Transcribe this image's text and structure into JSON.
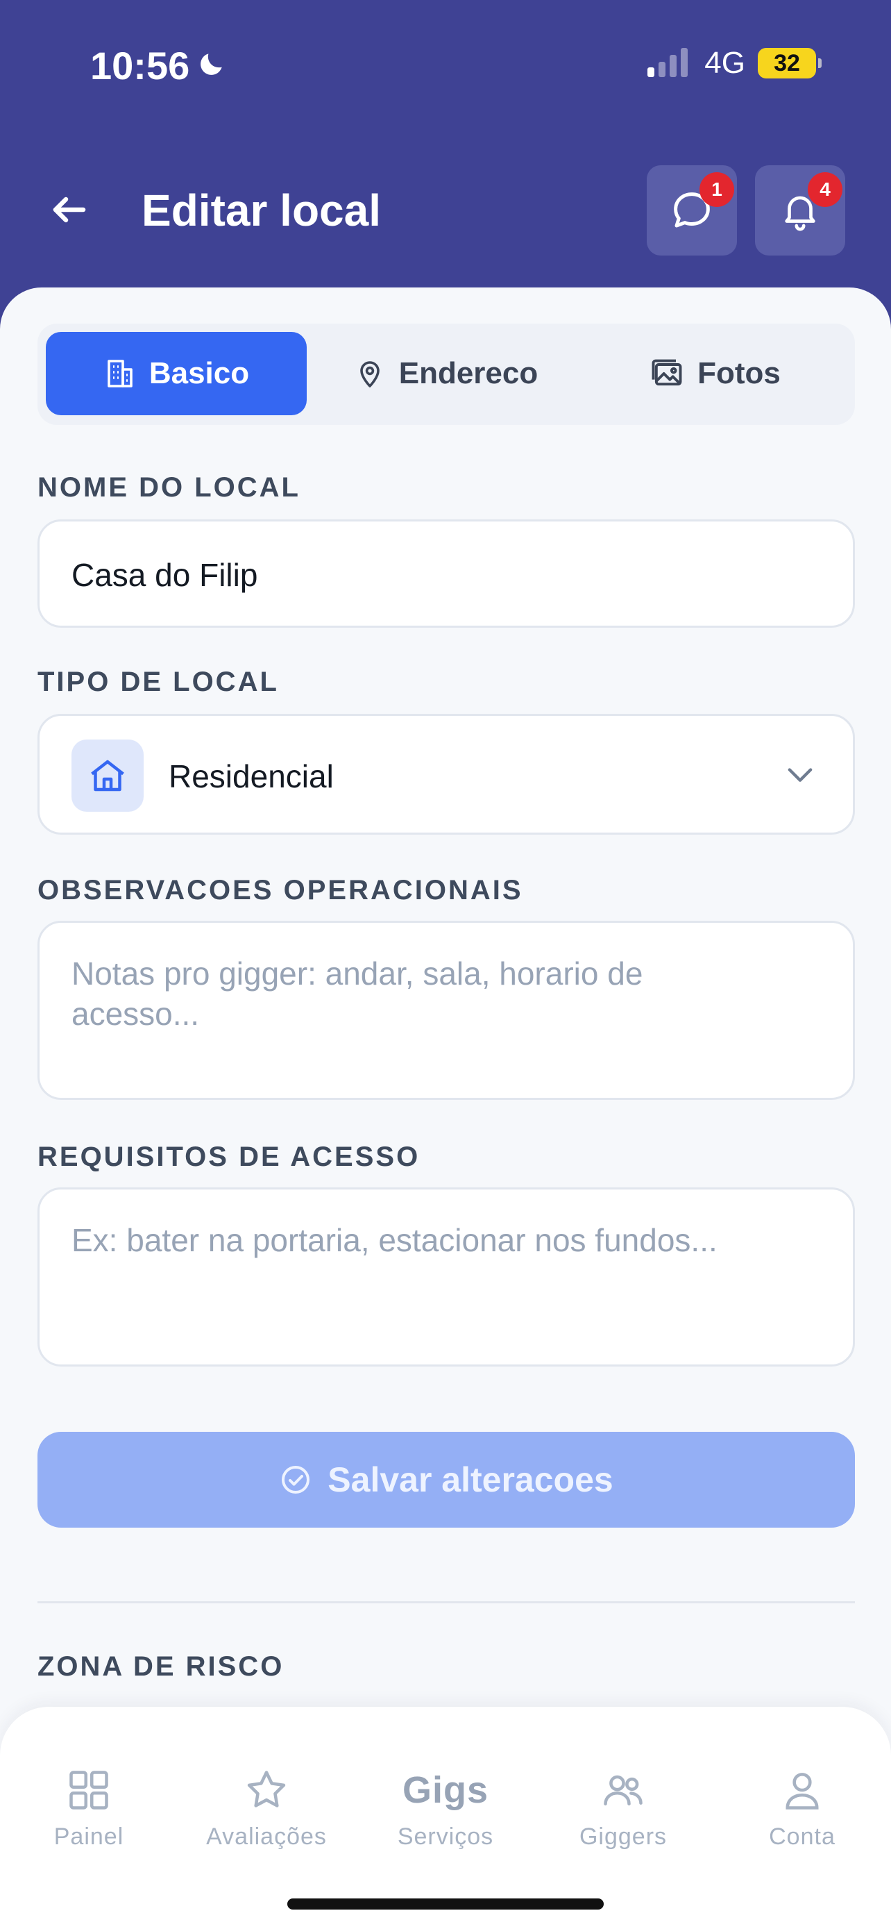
{
  "status_bar": {
    "time": "10:56",
    "network": "4G",
    "battery": "32"
  },
  "header": {
    "title": "Editar local",
    "messages_badge": "1",
    "notifications_badge": "4"
  },
  "tabs": [
    {
      "label": "Basico",
      "icon": "building-icon",
      "active": true
    },
    {
      "label": "Endereco",
      "icon": "map-pin-icon",
      "active": false
    },
    {
      "label": "Fotos",
      "icon": "image-icon",
      "active": false
    }
  ],
  "form": {
    "name_label": "NOME DO LOCAL",
    "name_value": "Casa do Filip",
    "type_label": "TIPO DE LOCAL",
    "type_value": "Residencial",
    "notes_label": "OBSERVACOES OPERACIONAIS",
    "notes_placeholder": "Notas pro gigger: andar, sala, horario de acesso...",
    "access_label": "REQUISITOS DE ACESSO",
    "access_placeholder": "Ex: bater na portaria, estacionar nos fundos...",
    "save_label": "Salvar alteracoes",
    "danger_label": "ZONA DE RISCO"
  },
  "bottom_nav": {
    "items": [
      {
        "label": "Painel",
        "icon": "grid-icon"
      },
      {
        "label": "Avaliações",
        "icon": "star-icon"
      },
      {
        "label": "Serviços",
        "icon": "gigs-logo",
        "logo_text": "Gigs"
      },
      {
        "label": "Giggers",
        "icon": "users-icon"
      },
      {
        "label": "Conta",
        "icon": "user-icon"
      }
    ]
  },
  "colors": {
    "header_bg": "#3f4294",
    "accent": "#3567f2",
    "badge": "#e3262e",
    "save_disabled": "#94aff5"
  }
}
